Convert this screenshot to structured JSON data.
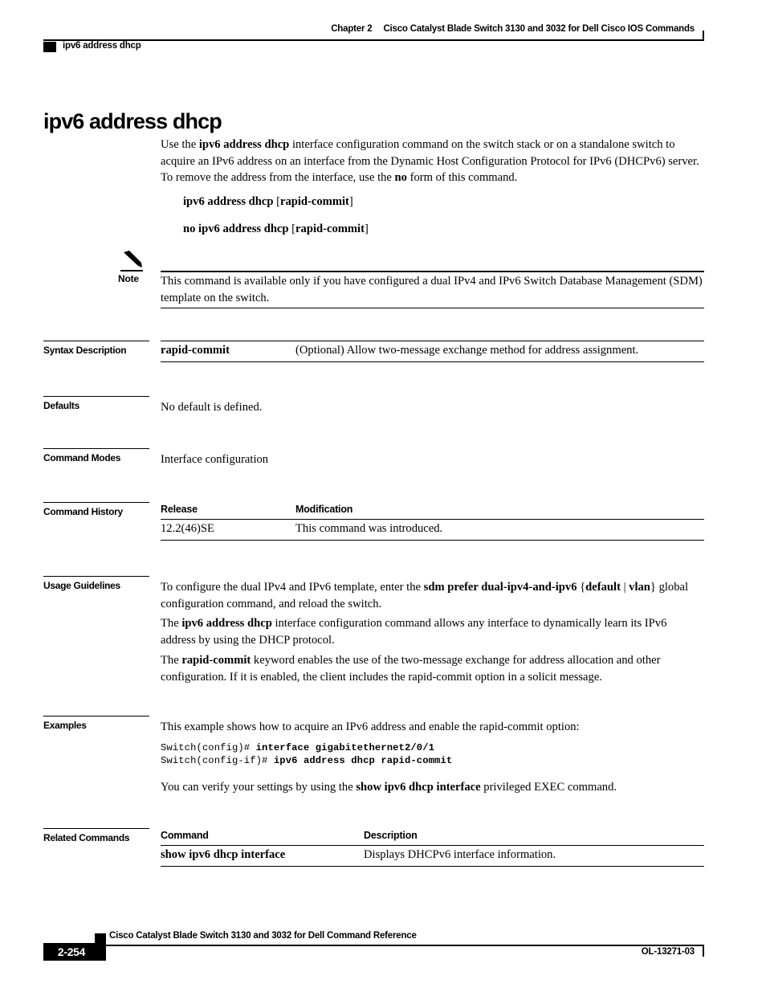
{
  "header": {
    "chapter": "Chapter 2",
    "book_title": "Cisco Catalyst Blade Switch 3130 and 3032 for Dell Cisco IOS Commands",
    "running_command": "ipv6 address dhcp"
  },
  "page": {
    "command_title": "ipv6 address dhcp"
  },
  "intro": {
    "part1": "Use the ",
    "command_bold": "ipv6 address dhcp",
    "part2": " interface configuration command on the switch stack or on a standalone switch to acquire an IPv6 address on an interface from the Dynamic Host Configuration Protocol for IPv6 (DHCPv6) server. To remove the address from the interface, use the ",
    "no_bold": "no",
    "part3": " form of this command."
  },
  "syntax": {
    "line1_command": "ipv6 address dhcp",
    "line1_open": " [",
    "line1_keyword": "rapid-commit",
    "line1_close": "]",
    "line2_command": "no ipv6 address dhcp",
    "line2_open": " [",
    "line2_keyword": "rapid-commit",
    "line2_close": "]"
  },
  "note": {
    "label": "Note",
    "icon": "pencil-icon",
    "text": "This command is available only if you have configured a dual IPv4 and IPv6 Switch Database Management (SDM) template on the switch."
  },
  "sections": {
    "syntax_description": "Syntax Description",
    "defaults": "Defaults",
    "command_modes": "Command Modes",
    "command_history": "Command History",
    "usage_guidelines": "Usage Guidelines",
    "examples": "Examples",
    "related_commands": "Related Commands"
  },
  "syntax_description_table": {
    "rows": [
      {
        "keyword": "rapid-commit",
        "description": "(Optional) Allow two-message exchange method for address assignment."
      }
    ]
  },
  "defaults": {
    "text": "No default is defined."
  },
  "command_modes": {
    "text": "Interface configuration"
  },
  "command_history_table": {
    "headers": [
      "Release",
      "Modification"
    ],
    "rows": [
      {
        "release": "12.2(46)SE",
        "modification": "This command was introduced."
      }
    ]
  },
  "usage_guidelines": {
    "p1_a": "To configure the dual IPv4 and IPv6 template, enter the ",
    "p1_bold1": "sdm prefer dual-ipv4-and-ipv6",
    "p1_brace_open": " {",
    "p1_bold2": "default",
    "p1_pipe": " | ",
    "p1_bold3": "vlan",
    "p1_brace_close": "}",
    "p1_b": " global configuration command, and reload the switch.",
    "p2_a": "The ",
    "p2_bold": "ipv6 address dhcp",
    "p2_b": " interface configuration command allows any interface to dynamically learn its IPv6 address by using the DHCP protocol.",
    "p3_a": "The ",
    "p3_bold": "rapid-commit",
    "p3_b": " keyword enables the use of the two-message exchange for address allocation and other configuration. If it is enabled, the client includes the rapid-commit option in a solicit message."
  },
  "examples": {
    "intro": "This example shows how to acquire an IPv6 address and enable the rapid-commit option:",
    "cli_lines": [
      {
        "prompt": "Switch(config)# ",
        "command": "interface gigabitethernet2/0/1"
      },
      {
        "prompt": "Switch(config-if)# ",
        "command": "ipv6 address dhcp rapid-commit"
      }
    ],
    "verify_a": "You can verify your settings by using the ",
    "verify_bold": "show ipv6 dhcp interface",
    "verify_b": " privileged EXEC command."
  },
  "related_commands_table": {
    "headers": [
      "Command",
      "Description"
    ],
    "rows": [
      {
        "command": "show ipv6 dhcp interface",
        "description": "Displays DHCPv6 interface information."
      }
    ]
  },
  "footer": {
    "page_number": "2-254",
    "doc_title": "Cisco Catalyst Blade Switch 3130 and 3032 for Dell Command Reference",
    "doc_id": "OL-13271-03"
  }
}
